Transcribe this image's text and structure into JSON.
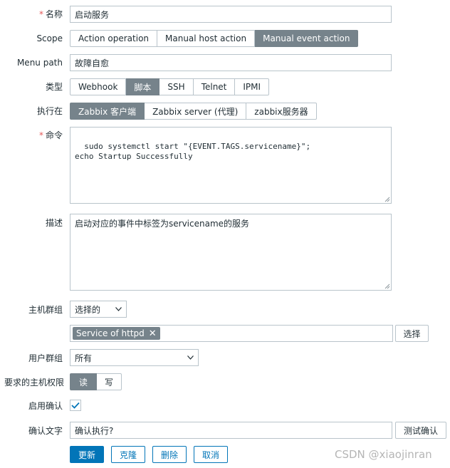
{
  "form": {
    "name": {
      "label": "名称",
      "value": "启动服务"
    },
    "scope": {
      "label": "Scope",
      "options": [
        "Action operation",
        "Manual host action",
        "Manual event action"
      ],
      "selected": "Manual event action"
    },
    "menu_path": {
      "label": "Menu path",
      "value": "故障自愈"
    },
    "type": {
      "label": "类型",
      "options": [
        "Webhook",
        "脚本",
        "SSH",
        "Telnet",
        "IPMI"
      ],
      "selected": "脚本"
    },
    "execute_on": {
      "label": "执行在",
      "options": [
        "Zabbix 客户端",
        "Zabbix server (代理)",
        "zabbix服务器"
      ],
      "selected": "Zabbix 客户端"
    },
    "command": {
      "label": "命令",
      "value": "sudo systemctl start \"{EVENT.TAGS.servicename}\";\necho Startup Successfully"
    },
    "description": {
      "label": "描述",
      "value": "启动对应的事件中标签为servicename的服务"
    },
    "host_group": {
      "label": "主机群组",
      "select_value": "选择的",
      "tag": "Service of httpd",
      "select_button": "选择"
    },
    "user_group": {
      "label": "用户群组",
      "value": "所有"
    },
    "host_permission": {
      "label": "要求的主机权限",
      "options": [
        "读",
        "写"
      ],
      "selected": "读"
    },
    "enable_confirm": {
      "label": "启用确认",
      "checked": true
    },
    "confirm_text": {
      "label": "确认文字",
      "value": "确认执行?",
      "test_button": "测试确认"
    }
  },
  "actions": {
    "update": "更新",
    "clone": "克隆",
    "delete": "删除",
    "cancel": "取消"
  },
  "watermark": "CSDN @xiaojinran",
  "colors": {
    "active_segment": "#76838b",
    "primary": "#0275b8",
    "required": "#e45959",
    "border": "#b9c4cb"
  }
}
